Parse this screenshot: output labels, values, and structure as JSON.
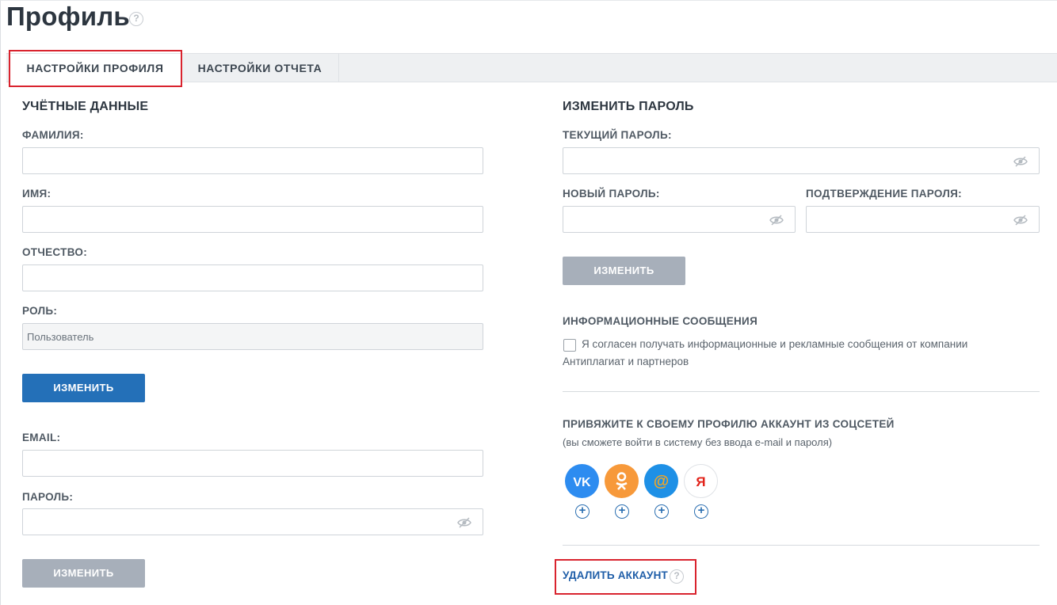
{
  "page": {
    "title": "Профиль"
  },
  "tabs": [
    {
      "label": "НАСТРОЙКИ ПРОФИЛЯ",
      "active": true
    },
    {
      "label": "НАСТРОЙКИ ОТЧЕТА",
      "active": false
    }
  ],
  "account": {
    "heading": "УЧЁТНЫЕ ДАННЫЕ",
    "surname_label": "ФАМИЛИЯ:",
    "surname_value": "",
    "name_label": "ИМЯ:",
    "name_value": "",
    "patronymic_label": "ОТЧЕСТВО:",
    "patronymic_value": "",
    "role_label": "РОЛЬ:",
    "role_value": "Пользователь",
    "change_button": "ИЗМЕНИТЬ",
    "email_label": "EMAIL:",
    "email_value": "",
    "password_label": "ПАРОЛЬ:",
    "password_value": "",
    "change_password_button": "ИЗМЕНИТЬ"
  },
  "password_change": {
    "heading": "ИЗМЕНИТЬ ПАРОЛЬ",
    "current_label": "ТЕКУЩИЙ ПАРОЛЬ:",
    "new_label": "НОВЫЙ ПАРОЛЬ:",
    "confirm_label": "ПОДТВЕРЖДЕНИЕ ПАРОЛЯ:",
    "change_button": "ИЗМЕНИТЬ"
  },
  "info_messages": {
    "heading": "ИНФОРМАЦИОННЫЕ СООБЩЕНИЯ",
    "consent_line1": "Я согласен получать информационные и рекламные сообщения от компании",
    "consent_line2": "Антиплагиат и партнеров",
    "checked": false
  },
  "social": {
    "heading": "ПРИВЯЖИТЕ К СВОЕМУ ПРОФИЛЮ АККАУНТ ИЗ СОЦСЕТЕЙ",
    "subheading": "(вы сможете войти в систему без ввода e-mail и пароля)",
    "networks": [
      {
        "name": "vk-icon",
        "glyph": "VK",
        "color": "#2d8cf0"
      },
      {
        "name": "odnoklassniki-icon",
        "glyph": "ok",
        "color": "#f7993a"
      },
      {
        "name": "mailru-icon",
        "glyph": "@",
        "color": "#1e90e6"
      },
      {
        "name": "yandex-icon",
        "glyph": "Я",
        "color": "#ffffff"
      }
    ]
  },
  "delete_account": {
    "label": "УДАЛИТЬ АККАУНТ"
  },
  "colors": {
    "primary": "#2470b8",
    "disabled": "#a7afba",
    "highlight": "#d9232e"
  }
}
